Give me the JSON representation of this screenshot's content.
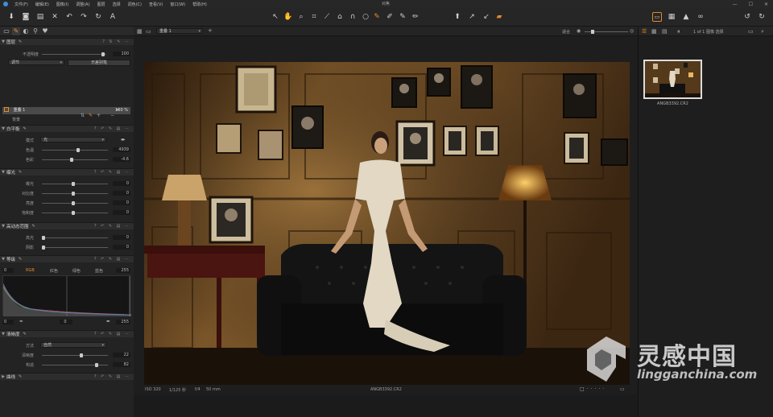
{
  "window": {
    "title": "对焦",
    "menu": [
      "文件(F)",
      "编辑(E)",
      "图像(I)",
      "调整(A)",
      "图层",
      "选择",
      "调色(C)",
      "查看(V)",
      "窗口(W)",
      "帮助(H)"
    ],
    "controls": [
      "—",
      "☐",
      "✕"
    ]
  },
  "left_panel": {
    "layers": {
      "title": "图层",
      "opacity_label": "不透明度",
      "opacity_value": "100",
      "adjust_select": "调节",
      "brush_button": "无差别笔",
      "layer_name": "重叠 1",
      "layer_value": "100 %",
      "background_name": "背景"
    },
    "white_balance": {
      "title": "白平衡",
      "mode_label": "模式",
      "mode_value": "光",
      "temp_label": "色温",
      "temp_value": "4939",
      "tint_label": "色彩",
      "tint_value": "-4.6",
      "temp_level": 0.55,
      "tint_level": 0.45
    },
    "exposure": {
      "title": "曝光",
      "rows": [
        {
          "label": "曝光",
          "value": "0",
          "level": 0.48
        },
        {
          "label": "对比度",
          "value": "0",
          "level": 0.48
        },
        {
          "label": "亮度",
          "value": "0",
          "level": 0.48
        },
        {
          "label": "饱和度",
          "value": "0",
          "level": 0.48
        }
      ]
    },
    "hdr": {
      "title": "高动态范围",
      "rows": [
        {
          "label": "高光",
          "value": "0",
          "level": 0.0
        },
        {
          "label": "阴影",
          "value": "0",
          "level": 0.0
        }
      ]
    },
    "levels": {
      "title": "等级",
      "low_value": "0",
      "high_value": "255",
      "tabs": [
        "RGB",
        "红色",
        "绿色",
        "蓝色"
      ],
      "bottom_low": "0",
      "bottom_mid": "0",
      "bottom_high": "255"
    },
    "clarity": {
      "title": "清晰度",
      "method_label": "方法",
      "method_value": "自然",
      "amount_label": "清晰度",
      "amount_value": "22",
      "amount_level": 0.6,
      "structure_label": "构造",
      "structure_value": "82",
      "structure_level": 0.85
    },
    "curve": {
      "title": "曲线"
    }
  },
  "canvas": {
    "layer_select": "重叠 1",
    "plus_label": "+",
    "fit_label": "适合",
    "meta": {
      "iso": "ISO 320",
      "shutter": "1/125 秒",
      "aperture": "f/4",
      "focal": "50 mm"
    },
    "filename": "ANGB3392.CR2"
  },
  "browser": {
    "count": "1 of 1 图像 选择",
    "thumb_filename": "ANGB3392.CR2"
  },
  "watermark": {
    "cn": "灵感中国",
    "en": "lingganchina.com"
  },
  "colors": {
    "accent": "#e6892b",
    "panel": "#232323",
    "wall": "#6b4a24"
  }
}
